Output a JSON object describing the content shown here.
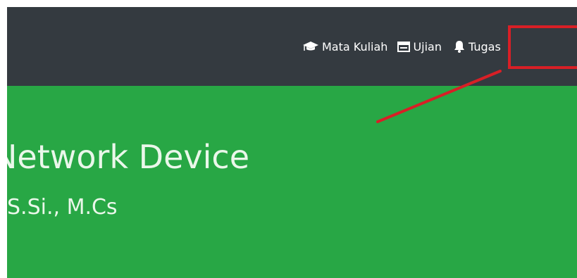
{
  "navbar": {
    "items": [
      {
        "label": "Mata Kuliah",
        "icon": "graduation-cap-icon"
      },
      {
        "label": "Ujian",
        "icon": "calendar-icon"
      },
      {
        "label": "Tugas",
        "icon": "bell-icon"
      }
    ]
  },
  "course": {
    "title": "Network Device",
    "lecturer": "S.Si., M.Cs"
  },
  "annotation": {
    "color": "#d81f26"
  },
  "colors": {
    "navbar_bg": "#343a40",
    "banner_bg": "#28a745"
  }
}
